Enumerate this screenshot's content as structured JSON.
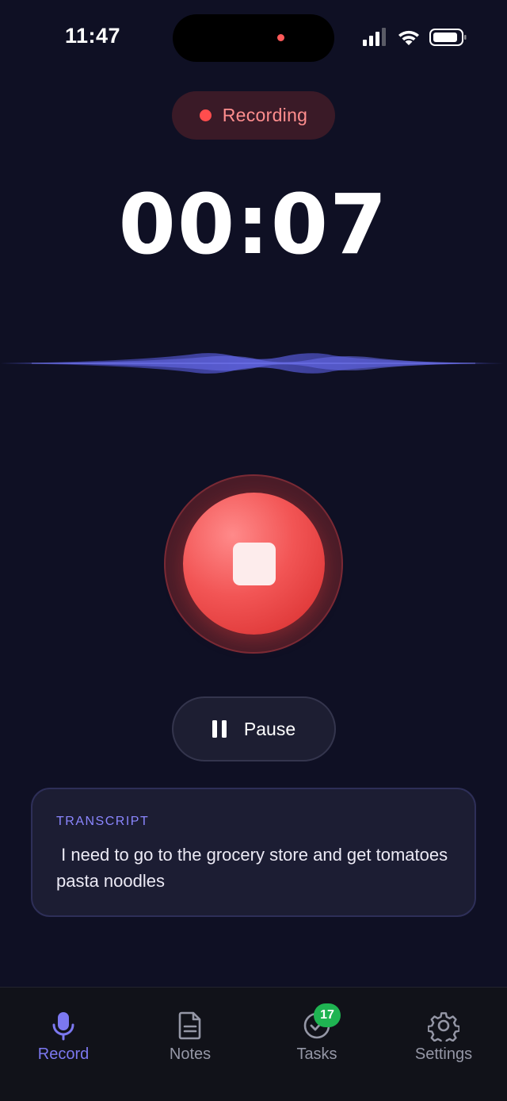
{
  "status_bar": {
    "time": "11:47"
  },
  "recording": {
    "status_label": "Recording",
    "timer": "00:07"
  },
  "controls": {
    "pause_label": "Pause"
  },
  "transcript": {
    "heading": "TRANSCRIPT",
    "text": " I need to go to the grocery store and get tomatoes pasta noodles"
  },
  "nav": {
    "items": [
      {
        "label": "Record",
        "icon": "microphone-icon",
        "active": true
      },
      {
        "label": "Notes",
        "icon": "document-icon",
        "active": false
      },
      {
        "label": "Tasks",
        "icon": "check-circle-icon",
        "active": false,
        "badge": "17"
      },
      {
        "label": "Settings",
        "icon": "gear-icon",
        "active": false
      }
    ]
  },
  "colors": {
    "background": "#0f1024",
    "accent": "#7c78f0",
    "recording_red": "#ff4d4d",
    "badge_green": "#1fb452"
  }
}
